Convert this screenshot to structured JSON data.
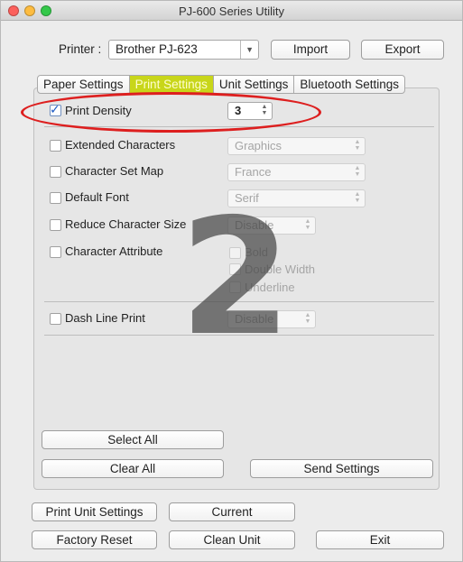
{
  "window": {
    "title": "PJ-600 Series Utility"
  },
  "printer": {
    "label": "Printer :",
    "selected": "Brother PJ-623",
    "import_label": "Import",
    "export_label": "Export"
  },
  "tabs": [
    "Paper Settings",
    "Print Settings",
    "Unit Settings",
    "Bluetooth Settings"
  ],
  "active_tab": "Print Settings",
  "settings": {
    "print_density": {
      "label": "Print Density",
      "checked": true,
      "value": "3"
    },
    "extended_characters": {
      "label": "Extended Characters",
      "checked": false,
      "value": "Graphics"
    },
    "character_set_map": {
      "label": "Character Set Map",
      "checked": false,
      "value": "France"
    },
    "default_font": {
      "label": "Default Font",
      "checked": false,
      "value": "Serif"
    },
    "reduce_character_size": {
      "label": "Reduce Character Size",
      "checked": false,
      "value": "Disable"
    },
    "character_attribute": {
      "label": "Character Attribute",
      "checked": false,
      "options": [
        "Bold",
        "Double Width",
        "Underline"
      ]
    },
    "dash_line_print": {
      "label": "Dash Line Print",
      "checked": false,
      "value": "Disable"
    }
  },
  "buttons": {
    "select_all": "Select All",
    "clear_all": "Clear All",
    "send_settings": "Send Settings",
    "print_unit_settings": "Print Unit Settings",
    "current": "Current",
    "factory_reset": "Factory Reset",
    "clean_unit": "Clean Unit",
    "exit": "Exit"
  },
  "annotation": {
    "step_number": "2",
    "highlight_color": "#dd1f1f"
  },
  "colors": {
    "active_tab": "#c8d61a",
    "check": "#1d5bc4"
  }
}
